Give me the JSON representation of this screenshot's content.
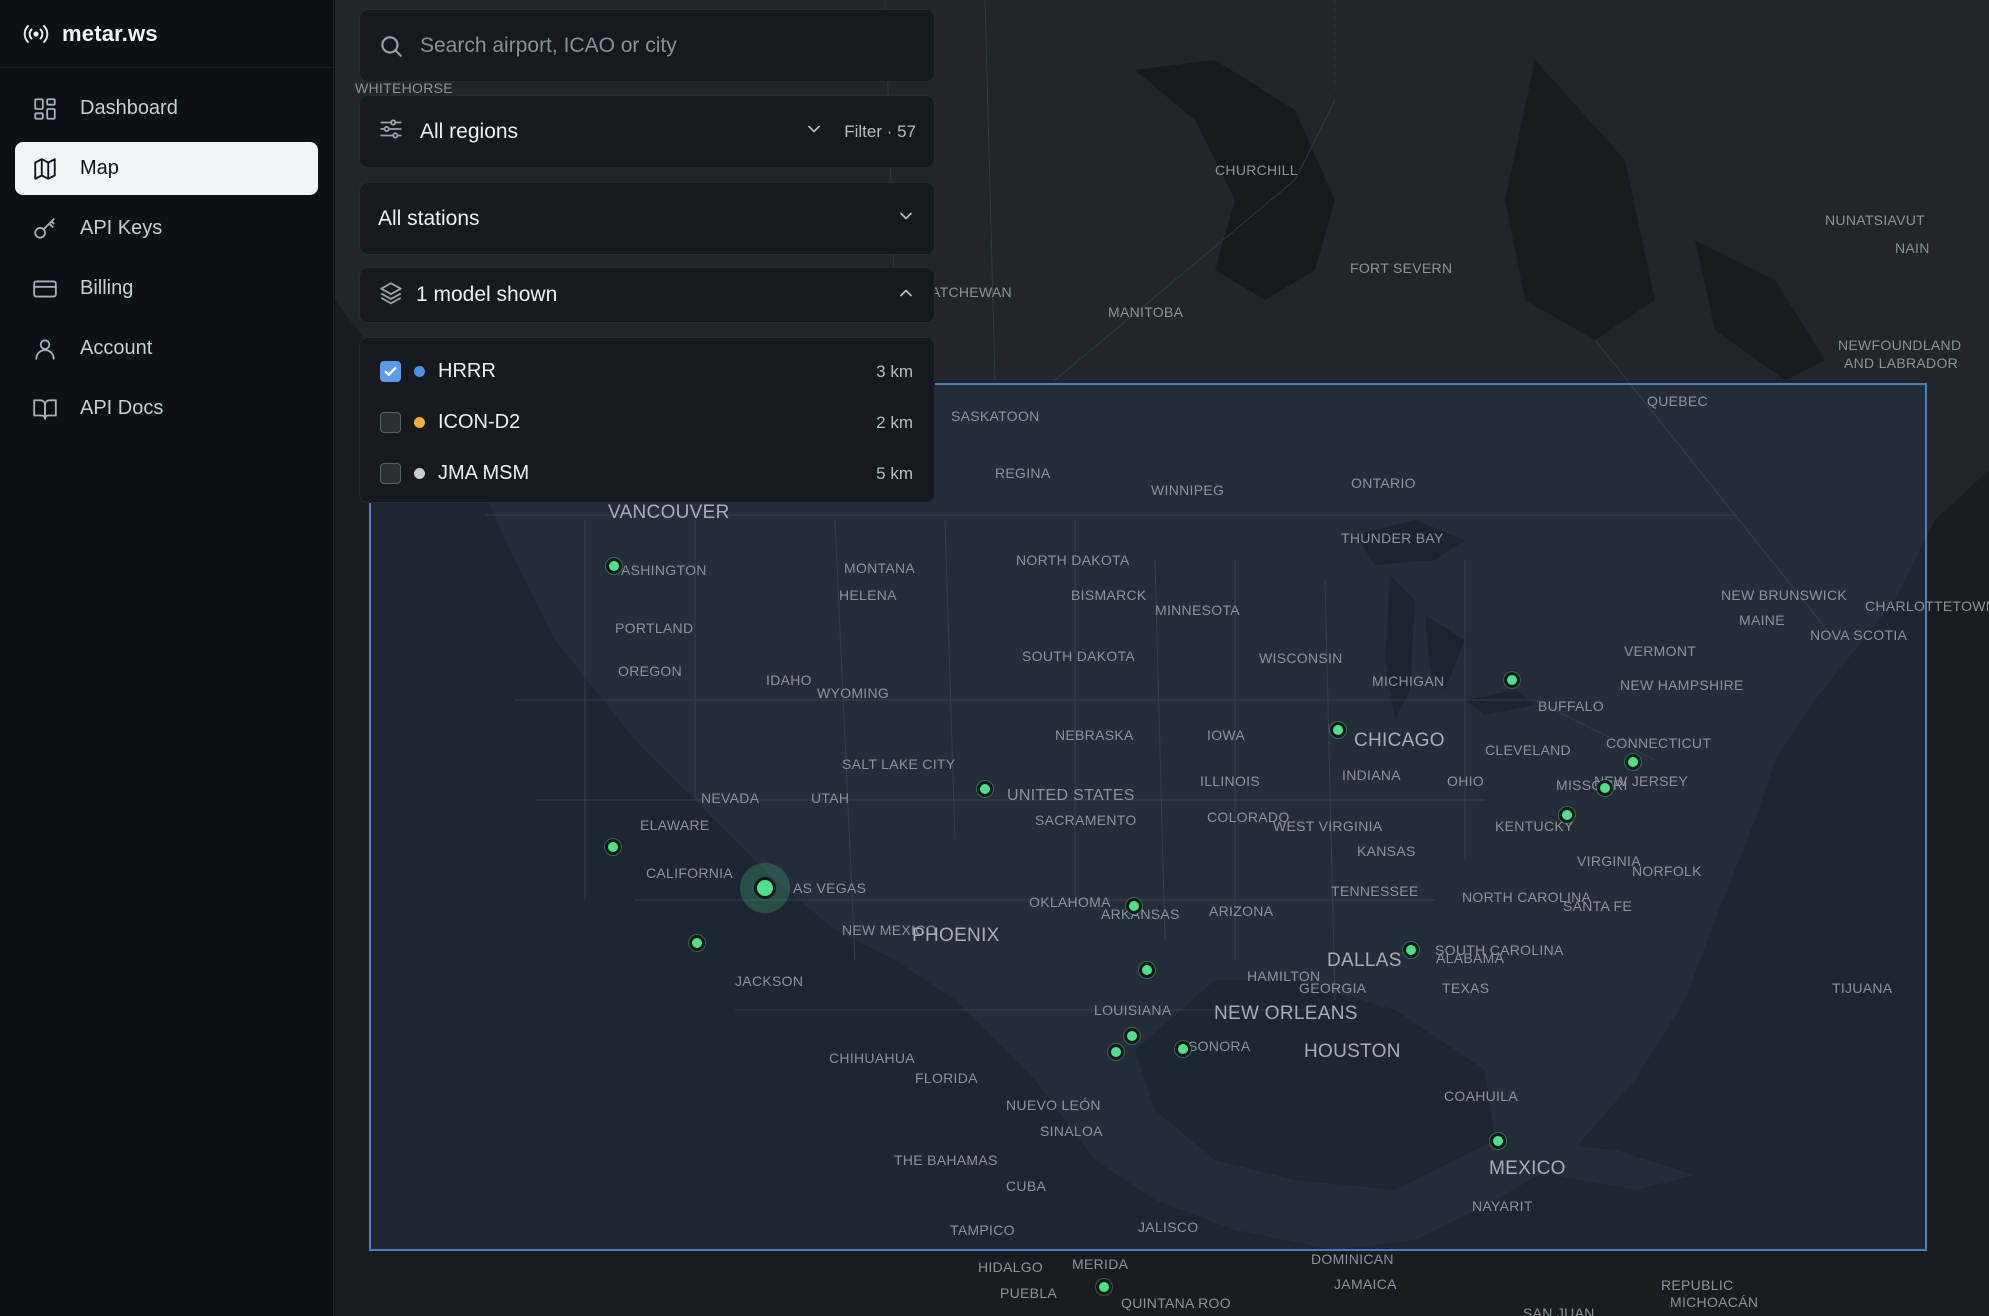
{
  "brand": {
    "name": "metar.ws",
    "icon": "broadcast-icon"
  },
  "sidebar": {
    "items": [
      {
        "label": "Dashboard",
        "icon": "dashboard-icon",
        "active": false
      },
      {
        "label": "Map",
        "icon": "map-icon",
        "active": true
      },
      {
        "label": "API Keys",
        "icon": "key-icon",
        "active": false
      },
      {
        "label": "Billing",
        "icon": "credit-card-icon",
        "active": false
      },
      {
        "label": "Account",
        "icon": "user-icon",
        "active": false
      },
      {
        "label": "API Docs",
        "icon": "book-icon",
        "active": false
      }
    ]
  },
  "search": {
    "placeholder": "Search airport, ICAO or city",
    "value": ""
  },
  "regions": {
    "label": "All regions",
    "filter": "Filter · 57"
  },
  "stations": {
    "label": "All stations"
  },
  "models": {
    "header": "1 model shown",
    "items": [
      {
        "name": "HRRR",
        "resolution": "3 km",
        "checked": true,
        "color": "#4d8fe0"
      },
      {
        "name": "ICON-D2",
        "resolution": "2 km",
        "checked": false,
        "color": "#f0b13c"
      },
      {
        "name": "JMA MSM",
        "resolution": "5 km",
        "checked": false,
        "color": "#c9cdd3"
      }
    ]
  },
  "colors": {
    "accent": "#5b9be8",
    "station": "#4ee08a",
    "domain_border": "#4a7fc4"
  },
  "map": {
    "labels": [
      {
        "text": "WHITEHORSE",
        "size": "small"
      },
      {
        "text": "CHURCHILL",
        "size": "small"
      },
      {
        "text": "NUNATSIAVUT",
        "size": "small"
      },
      {
        "text": "NAIN",
        "size": "small"
      },
      {
        "text": "FORT SEVERN",
        "size": "small"
      },
      {
        "text": "ATCHEWAN",
        "size": "small"
      },
      {
        "text": "MANITOBA",
        "size": "small"
      },
      {
        "text": "NEWFOUNDLAND",
        "size": "small"
      },
      {
        "text": "AND LABRADOR",
        "size": "small"
      },
      {
        "text": "QUEBEC",
        "size": "small"
      },
      {
        "text": "SASKATOON",
        "size": "small"
      },
      {
        "text": "REGINA",
        "size": "small"
      },
      {
        "text": "WINNIPEG",
        "size": "small"
      },
      {
        "text": "ONTARIO",
        "size": "small"
      },
      {
        "text": "VANCOUVER",
        "size": "big"
      },
      {
        "text": "THUNDER BAY",
        "size": "small"
      },
      {
        "text": "ASHINGTON",
        "size": "small"
      },
      {
        "text": "MONTANA",
        "size": "small"
      },
      {
        "text": "NORTH DAKOTA",
        "size": "small"
      },
      {
        "text": "HELENA",
        "size": "small"
      },
      {
        "text": "BISMARCK",
        "size": "small"
      },
      {
        "text": "NEW BRUNSWICK",
        "size": "small"
      },
      {
        "text": "CHARLOTTETOWN",
        "size": "small"
      },
      {
        "text": "MINNESOTA",
        "size": "small"
      },
      {
        "text": "MAINE",
        "size": "small"
      },
      {
        "text": "NOVA SCOTIA",
        "size": "small"
      },
      {
        "text": "PORTLAND",
        "size": "small"
      },
      {
        "text": "SOUTH DAKOTA",
        "size": "small"
      },
      {
        "text": "WISCONSIN",
        "size": "small"
      },
      {
        "text": "VERMONT",
        "size": "small"
      },
      {
        "text": "OREGON",
        "size": "small"
      },
      {
        "text": "IDAHO",
        "size": "small"
      },
      {
        "text": "MICHIGAN",
        "size": "small"
      },
      {
        "text": "NEW HAMPSHIRE",
        "size": "small"
      },
      {
        "text": "WYOMING",
        "size": "small"
      },
      {
        "text": "BUFFALO",
        "size": "small"
      },
      {
        "text": "NEBRASKA",
        "size": "small"
      },
      {
        "text": "IOWA",
        "size": "small"
      },
      {
        "text": "CHICAGO",
        "size": "big"
      },
      {
        "text": "CONNECTICUT",
        "size": "small"
      },
      {
        "text": "CLEVELAND",
        "size": "small"
      },
      {
        "text": "SALT LAKE CITY",
        "size": "small"
      },
      {
        "text": "INDIANA",
        "size": "small"
      },
      {
        "text": "NEVADA",
        "size": "small"
      },
      {
        "text": "UTAH",
        "size": "small"
      },
      {
        "text": "ILLINOIS",
        "size": "small"
      },
      {
        "text": "OHIO",
        "size": "small"
      },
      {
        "text": "NEW JERSEY",
        "size": "small"
      },
      {
        "text": "UNITED STATES",
        "size": "med"
      },
      {
        "text": "COLORADO",
        "size": "small"
      },
      {
        "text": "MISSOURI",
        "size": "small"
      },
      {
        "text": "ELAWARE",
        "size": "small"
      },
      {
        "text": "SACRAMENTO",
        "size": "small"
      },
      {
        "text": "WEST VIRGINIA",
        "size": "small"
      },
      {
        "text": "KANSAS",
        "size": "small"
      },
      {
        "text": "KENTUCKY",
        "size": "small"
      },
      {
        "text": "VIRGINIA",
        "size": "small"
      },
      {
        "text": "CALIFORNIA",
        "size": "small"
      },
      {
        "text": "NORFOLK",
        "size": "small"
      },
      {
        "text": "AS VEGAS",
        "size": "small"
      },
      {
        "text": "TENNESSEE",
        "size": "small"
      },
      {
        "text": "NORTH CAROLINA",
        "size": "small"
      },
      {
        "text": "SANTA FE",
        "size": "small"
      },
      {
        "text": "OKLAHOMA",
        "size": "small"
      },
      {
        "text": "ARKANSAS",
        "size": "small"
      },
      {
        "text": "ARIZONA",
        "size": "small"
      },
      {
        "text": "NEW MEXICO",
        "size": "small"
      },
      {
        "text": "PHOENIX",
        "size": "big"
      },
      {
        "text": "SOUTH CAROLINA",
        "size": "small"
      },
      {
        "text": "ALABAMA",
        "size": "small"
      },
      {
        "text": "DALLAS",
        "size": "big"
      },
      {
        "text": "HAMILTON",
        "size": "small"
      },
      {
        "text": "TIJUANA",
        "size": "small"
      },
      {
        "text": "JACKSON",
        "size": "small"
      },
      {
        "text": "GEORGIA",
        "size": "small"
      },
      {
        "text": "TEXAS",
        "size": "small"
      },
      {
        "text": "LOUISIANA",
        "size": "small"
      },
      {
        "text": "NEW ORLEANS",
        "size": "big"
      },
      {
        "text": "HOUSTON",
        "size": "big"
      },
      {
        "text": "SONORA",
        "size": "small"
      },
      {
        "text": "CHIHUAHUA",
        "size": "small"
      },
      {
        "text": "FLORIDA",
        "size": "small"
      },
      {
        "text": "COAHUILA",
        "size": "small"
      },
      {
        "text": "NUEVO LEÓN",
        "size": "small"
      },
      {
        "text": "SINALOA",
        "size": "small"
      },
      {
        "text": "THE BAHAMAS",
        "size": "small"
      },
      {
        "text": "MEXICO",
        "size": "big"
      },
      {
        "text": "CUBA",
        "size": "small"
      },
      {
        "text": "NAYARIT",
        "size": "small"
      },
      {
        "text": "TAMPICO",
        "size": "small"
      },
      {
        "text": "JALISCO",
        "size": "small"
      },
      {
        "text": "HIDALGO",
        "size": "small"
      },
      {
        "text": "MERIDA",
        "size": "small"
      },
      {
        "text": "DOMINICAN",
        "size": "small"
      },
      {
        "text": "REPUBLIC",
        "size": "small"
      },
      {
        "text": "MICHOACÁN",
        "size": "small"
      },
      {
        "text": "PUEBLA",
        "size": "small"
      },
      {
        "text": "QUINTANA ROO",
        "size": "small"
      },
      {
        "text": "JAMAICA",
        "size": "small"
      },
      {
        "text": "SAN JUAN",
        "size": "small"
      }
    ]
  }
}
